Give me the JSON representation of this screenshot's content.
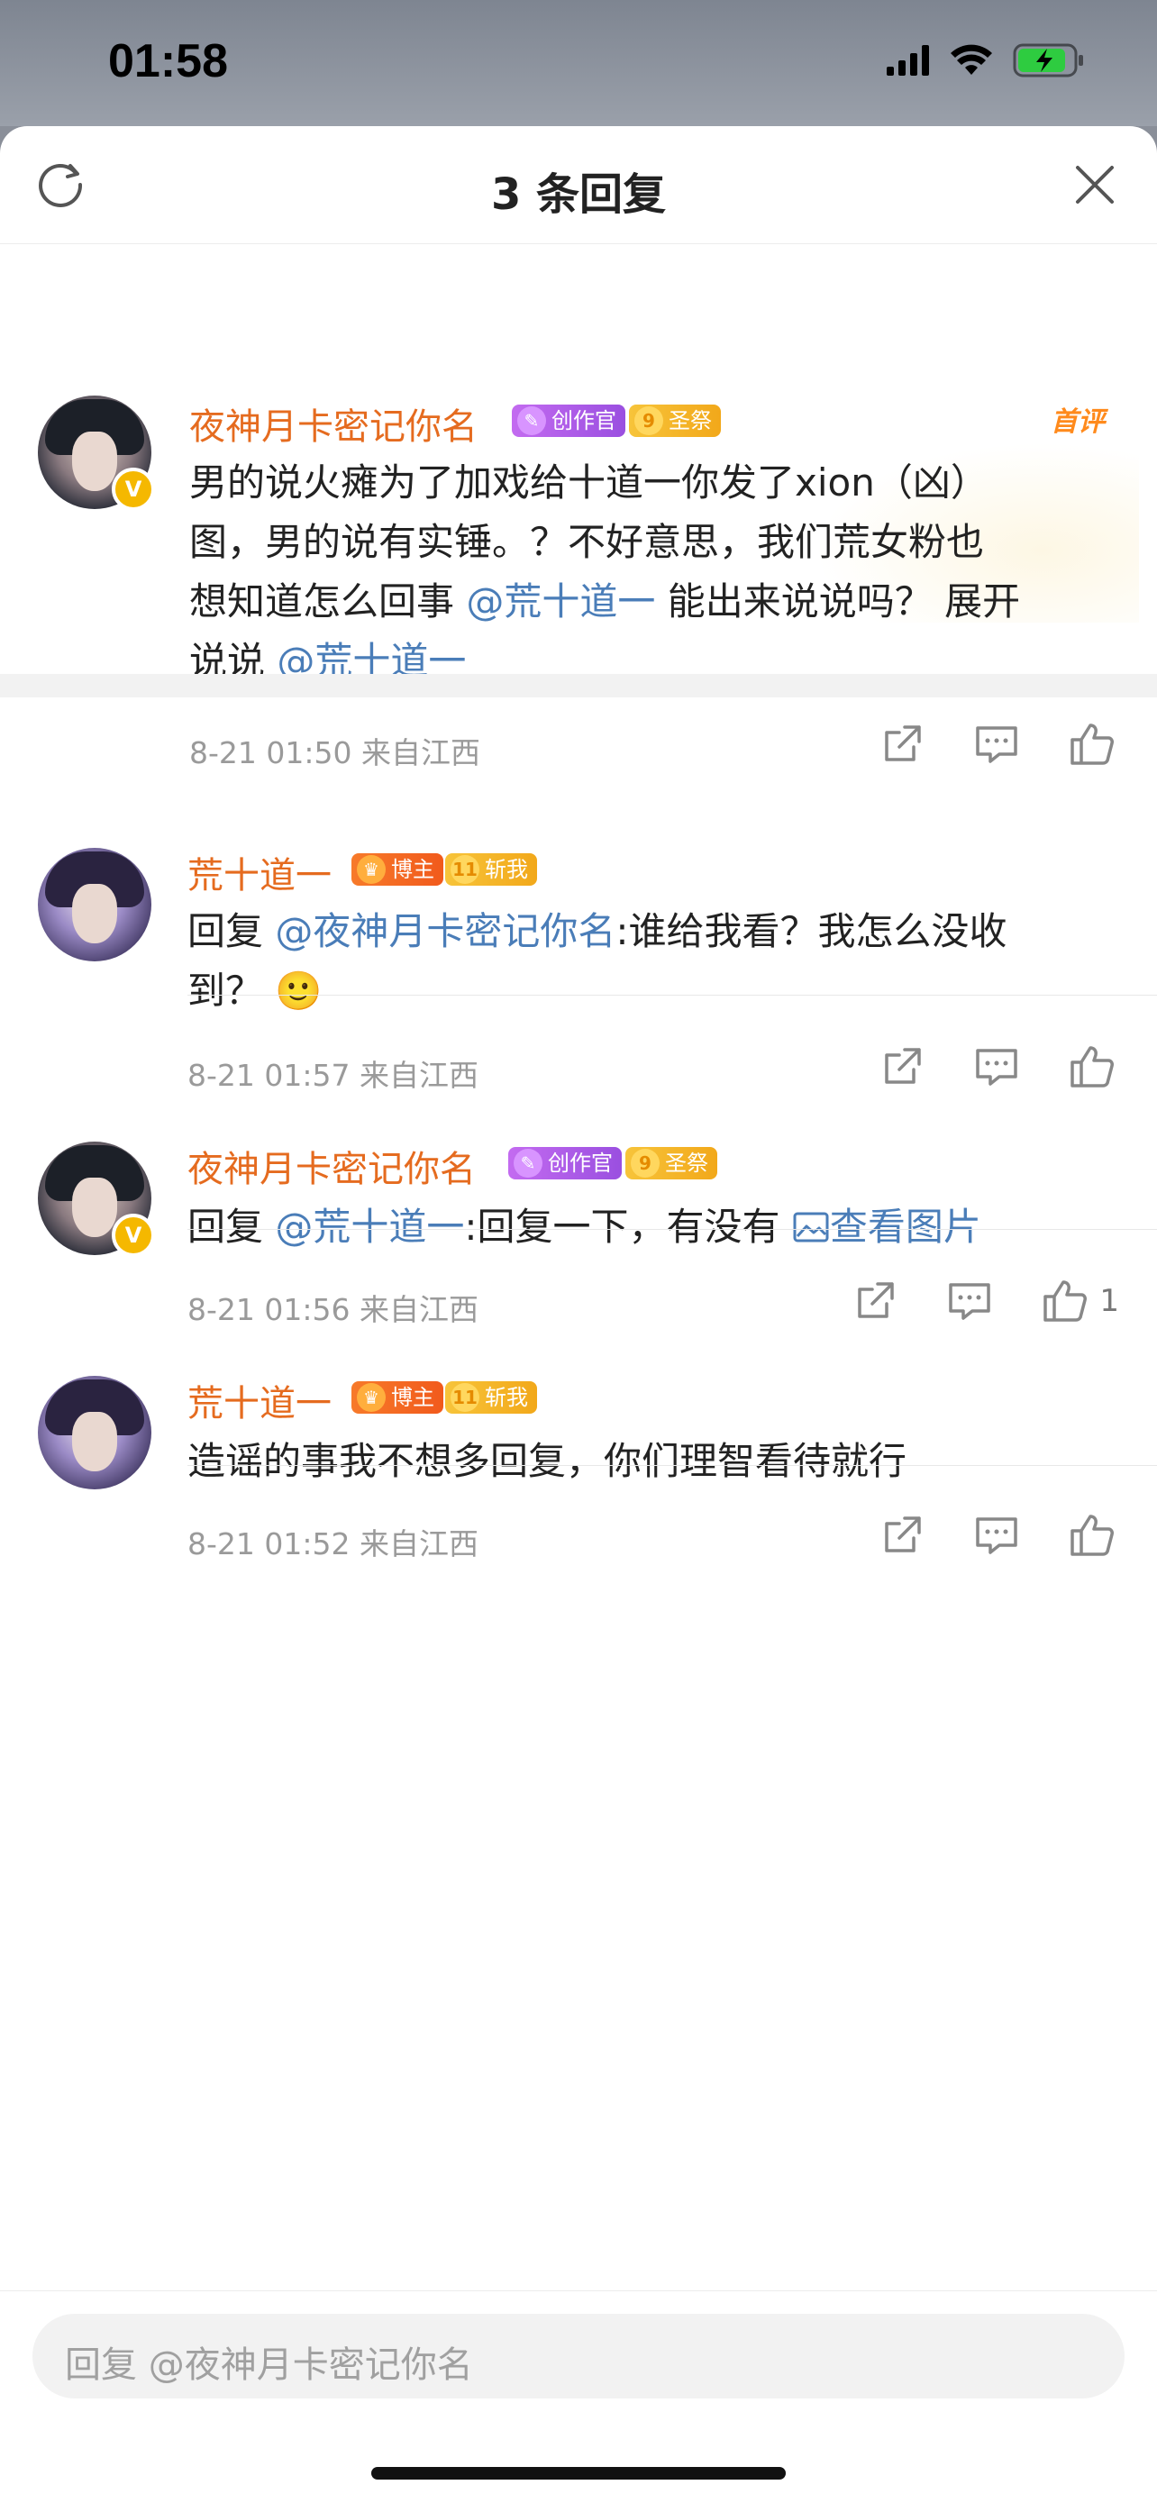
{
  "status_bar": {
    "time": "01:58"
  },
  "header": {
    "title": "3 条回复"
  },
  "comments": [
    {
      "username": "夜神月卡密记你名",
      "badges": [
        "创作官",
        "圣祭"
      ],
      "first_tag": "首评",
      "text_parts": [
        "男的说火瘫为了加戏给十道一你发了xion（凶）",
        "图，男的说有实锤。？不好意思，我们荒女粉也",
        "想知道怎么回事",
        "@荒十道一",
        "能出来说说吗？ 展开",
        "说说",
        "@荒十道一"
      ],
      "time": "8-21 01:50",
      "location": "来自江西"
    },
    {
      "username": "荒十道一",
      "badges": [
        "博主",
        "斩我"
      ],
      "reply_prefix": "回复",
      "mention": "@夜神月卡密记你名",
      "text_line1": ":谁给我看？我怎么没收",
      "text_line2": "到？",
      "emoji": "🙂",
      "time": "8-21 01:57",
      "location": "来自江西"
    },
    {
      "username": "夜神月卡密记你名",
      "badges": [
        "创作官",
        "圣祭"
      ],
      "reply_prefix": "回复",
      "mention": "@荒十道一",
      "text": ":回复一下，有没有",
      "image_link": "查看图片",
      "time": "8-21 01:56",
      "location": "来自江西",
      "like_count": "1"
    },
    {
      "username": "荒十道一",
      "badges": [
        "博主",
        "斩我"
      ],
      "text": "造谣的事我不想多回复，你们理智看待就行",
      "time": "8-21 01:52",
      "location": "来自江西"
    }
  ],
  "reply_input": {
    "placeholder": "回复 @夜神月卡密记你名"
  },
  "icons": {
    "refresh": "refresh-icon",
    "close": "close-icon",
    "share": "share-icon",
    "comment": "comment-icon",
    "like": "like-icon"
  },
  "colors": {
    "username": "#e56b1f",
    "mention": "#4a7db8",
    "meta": "#9a9a9a"
  }
}
